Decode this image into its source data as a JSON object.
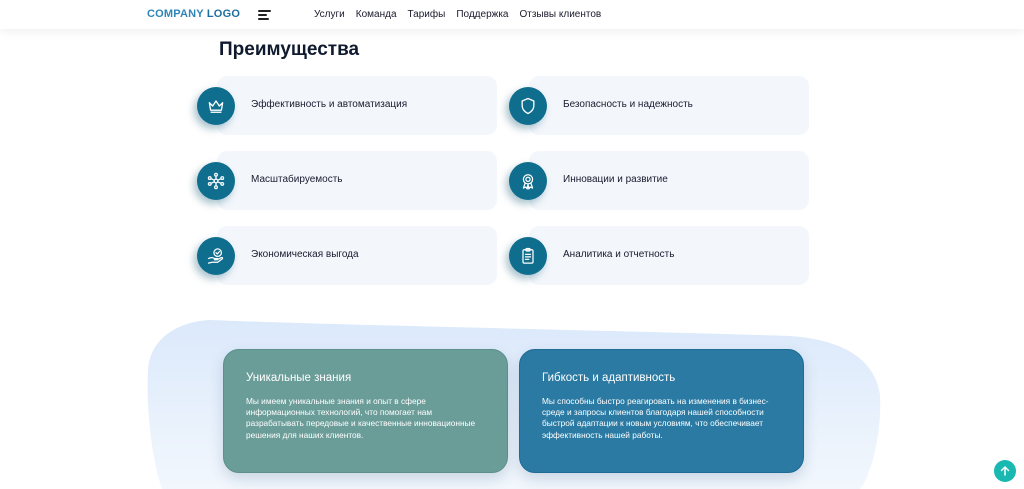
{
  "header": {
    "logo_part1": "COMPANY",
    "logo_part2": "LOGO",
    "menu_icon": "hamburger-icon",
    "nav": [
      "Услуги",
      "Команда",
      "Тарифы",
      "Поддержка",
      "Отзывы клиентов"
    ]
  },
  "advantages": {
    "title": "Преимущества",
    "items": [
      {
        "label": "Эффективность и автоматизация",
        "icon": "crown-icon"
      },
      {
        "label": "Безопасность и надежность",
        "icon": "shield-icon"
      },
      {
        "label": "Масштабируемость",
        "icon": "network-icon"
      },
      {
        "label": "Инновации и развитие",
        "icon": "award-icon"
      },
      {
        "label": "Экономическая выгода",
        "icon": "hand-check-icon"
      },
      {
        "label": "Аналитика и отчетность",
        "icon": "clipboard-icon"
      }
    ]
  },
  "info_cards": [
    {
      "title": "Уникальные знания",
      "text": "Мы имеем уникальные знания и опыт в сфере информационных технологий, что помогает нам разрабатывать передовые и качественные инновационные решения для наших клиентов."
    },
    {
      "title": "Гибкость и адаптивность",
      "text": "Мы способны быстро реагировать на изменения в бизнес-среде и запросы клиентов благодаря нашей способности быстрой адаптации к новым условиям, что обеспечивает эффективность нашей работы."
    }
  ],
  "scroll_top_icon": "arrow-up-icon",
  "colors": {
    "accent": "#0f6d8e",
    "card_green": "#6a9c98",
    "card_blue": "#2a7aa3",
    "scroll_button": "#19b8b0",
    "card_bg": "#f3f7fc"
  }
}
